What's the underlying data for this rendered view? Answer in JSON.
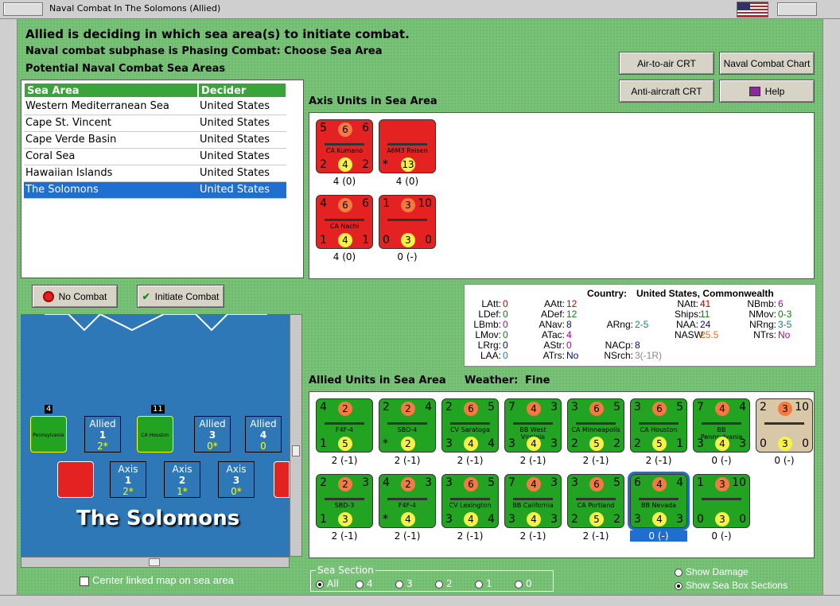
{
  "window": {
    "title": "Naval Combat In The Solomons (Allied)"
  },
  "header": {
    "line1": "Allied is deciding in which sea area(s) to initiate combat.",
    "line2": "Naval combat subphase is Phasing Combat: Choose Sea Area",
    "line3": "Potential Naval Combat Sea Areas"
  },
  "buttons": {
    "air_crt": "Air-to-air CRT",
    "naval_chart": "Naval Combat Chart",
    "aa_crt": "Anti-aircraft CRT",
    "help": "Help",
    "no_combat": "No Combat",
    "initiate": "Initiate Combat"
  },
  "table": {
    "headers": [
      "Sea Area",
      "Decider"
    ],
    "rows": [
      {
        "area": "Western Mediterranean Sea",
        "decider": "United States"
      },
      {
        "area": "Cape St. Vincent",
        "decider": "United States"
      },
      {
        "area": "Cape Verde Basin",
        "decider": "United States"
      },
      {
        "area": "Coral Sea",
        "decider": "United States"
      },
      {
        "area": "Hawaiian Islands",
        "decider": "United States"
      },
      {
        "area": "The Solomons",
        "decider": "United States"
      }
    ],
    "selected": 5
  },
  "axis": {
    "label": "Axis Units in Sea Area",
    "units": [
      {
        "tl": "5",
        "tc": "6",
        "tr": "6",
        "name": "CA Kumano",
        "bl": "2",
        "bc": "4",
        "br": "2",
        "cap": "4 (0)"
      },
      {
        "tl": "",
        "tc": "",
        "tr": "",
        "name": "A6M3 Reisen",
        "bl": "*",
        "bc": "13",
        "br": "",
        "cap": "4 (0)"
      },
      {
        "tl": "4",
        "tc": "6",
        "tr": "6",
        "name": "CA Nachi",
        "bl": "1",
        "bc": "4",
        "br": "1",
        "cap": "4 (0)"
      },
      {
        "tl": "1",
        "tc": "3",
        "tr": "10",
        "name": "",
        "bl": "0",
        "bc": "3",
        "br": "0",
        "cap": "0 (-)"
      }
    ]
  },
  "stats": {
    "country_label": "Country:",
    "country": "United States, Commonwealth",
    "items": [
      {
        "k": "LAtt:",
        "v": "0"
      },
      {
        "k": "LDef:",
        "v": "0"
      },
      {
        "k": "LBmb:",
        "v": "0"
      },
      {
        "k": "LMov:",
        "v": "0"
      },
      {
        "k": "LRrg:",
        "v": "0"
      },
      {
        "k": "LAA:",
        "v": "0"
      },
      {
        "k": "AAtt:",
        "v": "12"
      },
      {
        "k": "ADef:",
        "v": "12"
      },
      {
        "k": "ANav:",
        "v": "8"
      },
      {
        "k": "ATac:",
        "v": "4"
      },
      {
        "k": "AStr:",
        "v": "0"
      },
      {
        "k": "ATrs:",
        "v": "No"
      },
      {
        "k": "ARng:",
        "v": "2-5"
      },
      {
        "k": "NACp:",
        "v": "8"
      },
      {
        "k": "NSrch:",
        "v": "3(-1R)"
      },
      {
        "k": "NAtt:",
        "v": "41"
      },
      {
        "k": "Ships:",
        "v": "11"
      },
      {
        "k": "NAA:",
        "v": "24"
      },
      {
        "k": "NASW:",
        "v": "25.5"
      },
      {
        "k": "NBmb:",
        "v": "6"
      },
      {
        "k": "NMov:",
        "v": "0-3"
      },
      {
        "k": "NRng:",
        "v": "3-5"
      },
      {
        "k": "NTrs:",
        "v": "No"
      }
    ]
  },
  "allied": {
    "label": "Allied Units in Sea Area",
    "weather_label": "Weather:",
    "weather": "Fine",
    "units": [
      {
        "tl": "4",
        "tc": "2",
        "tr": "",
        "name": "F4F-4",
        "bl": "1",
        "bc": "5",
        "br": "",
        "cap": "2 (-1)"
      },
      {
        "tl": "2",
        "tc": "2",
        "tr": "4",
        "name": "SBD-4",
        "bl": "*",
        "bc": "2",
        "br": "",
        "cap": "2 (-1)"
      },
      {
        "tl": "2",
        "tc": "6",
        "tr": "5",
        "name": "CV Saratoga",
        "bl": "3",
        "bc": "4",
        "br": "4",
        "cap": "2 (-1)"
      },
      {
        "tl": "7",
        "tc": "4",
        "tr": "3",
        "name": "BB West Virginia",
        "bl": "3",
        "bc": "4",
        "br": "3",
        "cap": "2 (-1)"
      },
      {
        "tl": "3",
        "tc": "6",
        "tr": "5",
        "name": "CA Minneapolis",
        "bl": "2",
        "bc": "5",
        "br": "2",
        "cap": "2 (-1)"
      },
      {
        "tl": "3",
        "tc": "6",
        "tr": "5",
        "name": "CA Houston",
        "bl": "2",
        "bc": "5",
        "br": "1",
        "cap": "2 (-1)"
      },
      {
        "tl": "7",
        "tc": "4",
        "tr": "4",
        "name": "BB Pennsylvania",
        "bl": "3",
        "bc": "4",
        "br": "3",
        "cap": "0 (-)"
      },
      {
        "tl": "2",
        "tc": "3",
        "tr": "10",
        "name": "",
        "bl": "0",
        "bc": "3",
        "br": "0",
        "cap": "0 (-)"
      },
      {
        "tl": "2",
        "tc": "2",
        "tr": "3",
        "name": "SBD-3",
        "bl": "1",
        "bc": "3",
        "br": "",
        "cap": "2 (-1)"
      },
      {
        "tl": "4",
        "tc": "2",
        "tr": "3",
        "name": "F4F-4",
        "bl": "*",
        "bc": "4",
        "br": "",
        "cap": "2 (-1)"
      },
      {
        "tl": "3",
        "tc": "6",
        "tr": "5",
        "name": "CV Lexington",
        "bl": "3",
        "bc": "4",
        "br": "4",
        "cap": "2 (-1)"
      },
      {
        "tl": "7",
        "tc": "4",
        "tr": "3",
        "name": "BB California",
        "bl": "3",
        "bc": "4",
        "br": "3",
        "cap": "2 (-1)"
      },
      {
        "tl": "3",
        "tc": "6",
        "tr": "5",
        "name": "CA Portland",
        "bl": "2",
        "bc": "5",
        "br": "2",
        "cap": "2 (-1)"
      },
      {
        "tl": "6",
        "tc": "4",
        "tr": "4",
        "name": "BB Nevada",
        "bl": "3",
        "bc": "4",
        "br": "3",
        "cap": "0 (-)"
      },
      {
        "tl": "1",
        "tc": "3",
        "tr": "10",
        "name": "",
        "bl": "0",
        "bc": "3",
        "br": "0",
        "cap": "0 (-)"
      }
    ]
  },
  "map": {
    "title": "The Solomons",
    "allied_boxes": [
      {
        "l": "Allied",
        "n": "1",
        "v": "2*"
      },
      {
        "l": "Allied",
        "n": "3",
        "v": "0*"
      },
      {
        "l": "Allied",
        "n": "4",
        "v": "0"
      }
    ],
    "axis_boxes": [
      {
        "l": "Axis",
        "n": "1",
        "v": "2*"
      },
      {
        "l": "Axis",
        "n": "2",
        "v": "1*"
      },
      {
        "l": "Axis",
        "n": "3",
        "v": "0*"
      }
    ],
    "counters": [
      {
        "t": "4",
        "n": "Pennsylvania"
      },
      {
        "t": "11",
        "n": "CA Houston"
      }
    ]
  },
  "footer": {
    "center_map": "Center linked map on sea area",
    "sea_section": "Sea Section",
    "sections": [
      "All",
      "4",
      "3",
      "2",
      "1",
      "0"
    ],
    "show_damage": "Show Damage",
    "show_sections": "Show Sea Box Sections"
  },
  "colors": {
    "panel_green": "#78c278",
    "unit_red": "#e52222",
    "unit_green": "#22a422",
    "selection": "#1f6fd0"
  }
}
